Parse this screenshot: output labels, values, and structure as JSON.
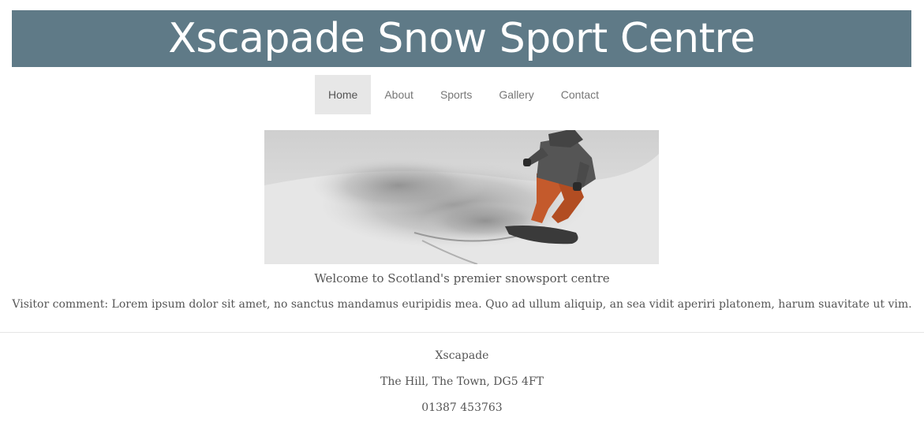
{
  "header": {
    "title": "Xscapade Snow Sport Centre"
  },
  "nav": {
    "items": [
      {
        "label": "Home",
        "active": true
      },
      {
        "label": "About",
        "active": false
      },
      {
        "label": "Sports",
        "active": false
      },
      {
        "label": "Gallery",
        "active": false
      },
      {
        "label": "Contact",
        "active": false
      }
    ]
  },
  "main": {
    "tagline": "Welcome to Scotland's premier snowsport centre",
    "comment": "Visitor comment: Lorem ipsum dolor sit amet, no sanctus mandamus euripidis mea. Quo ad ullum aliquip, an sea vidit aperiri platonem, harum suavitate ut vim."
  },
  "footer": {
    "name": "Xscapade",
    "address": "The Hill, The Town, DG5 4FT",
    "phone": "01387 453763"
  },
  "colors": {
    "banner": "#5f7a87",
    "nav_active_bg": "#e7e7e7",
    "text": "#555555"
  }
}
